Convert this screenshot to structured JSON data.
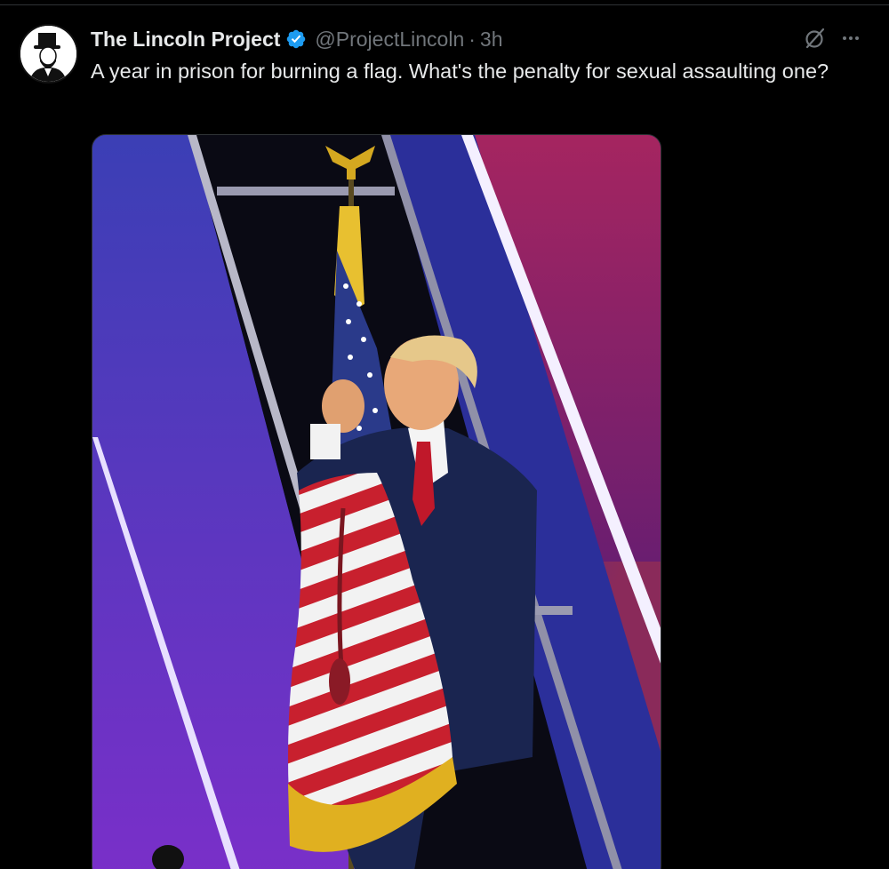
{
  "tweet": {
    "author": {
      "display_name": "The Lincoln Project",
      "handle": "@ProjectLincoln",
      "verified": true,
      "avatar_icon": "lincoln-portrait-avatar"
    },
    "separator": "·",
    "timestamp": "3h",
    "text": "A year in prison for burning a flag. What's the penalty for sexual assaulting one?",
    "actions": {
      "grok_icon": "grok-icon",
      "more_icon": "more-icon"
    },
    "media": {
      "icon": "photo-man-hugging-american-flag"
    }
  },
  "colors": {
    "background": "#000000",
    "text_primary": "#e7e9ea",
    "text_secondary": "#71767b",
    "verified_blue": "#1d9bf0",
    "divider": "#2f3336"
  }
}
